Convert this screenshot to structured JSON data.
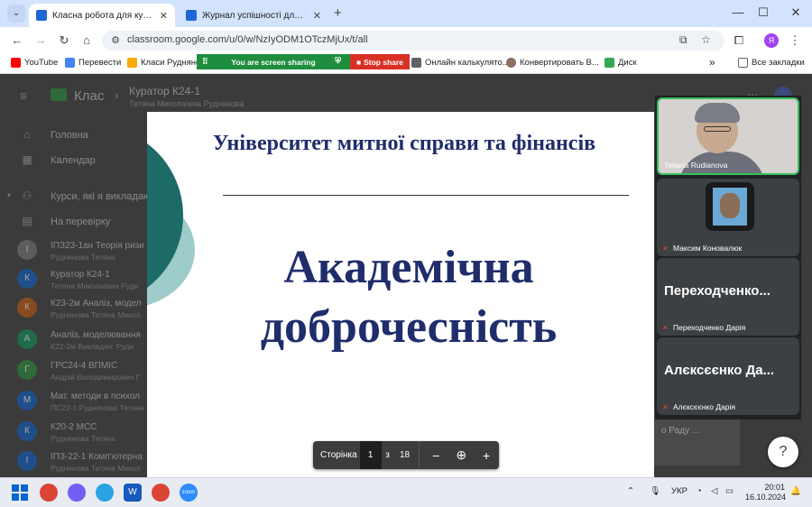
{
  "browser": {
    "tabs": [
      {
        "label": "Класна робота для курсу \"Кур",
        "active": true
      },
      {
        "label": "Журнал успішності для курсу \"",
        "active": false
      }
    ],
    "url": "classroom.google.com/u/0/w/NzIyODM1OTczMjUx/t/all",
    "profile_initial": "Я"
  },
  "bookmarks": {
    "items": [
      "YouTube",
      "Перевести",
      "Класи Руднянова",
      "Онлайн калькулято...",
      "Конвертировать В...",
      "Диск"
    ],
    "more": "»",
    "all_label": "Все закладки"
  },
  "screen_share": {
    "message": "You are screen sharing",
    "stop_label": "Stop share"
  },
  "classroom": {
    "app_name": "Клас",
    "course_title": "Куратор К24-1",
    "course_teacher": "Тетяна Миколаївна Руднянова",
    "nav": [
      {
        "label": "Головна",
        "icon": "home-icon"
      },
      {
        "label": "Календар",
        "icon": "calendar-icon"
      },
      {
        "label": "Курси, які я викладаю",
        "icon": "people-icon"
      },
      {
        "label": "На перевірку",
        "icon": "review-icon"
      }
    ],
    "courses": [
      {
        "initial": "І",
        "name": "ІПЗ23-1ан Теорія ризи",
        "teacher": "Руднянова Тетяна",
        "color": "#5c5c5c"
      },
      {
        "initial": "К",
        "name": "Куратор К24-1",
        "teacher": "Тетяна Миколаївна Рудн",
        "color": "#1f4f8a"
      },
      {
        "initial": "К",
        "name": "К23-2м Аналіз, модел",
        "teacher": "Руднянова Тетяна Микол",
        "color": "#8a4a1f"
      },
      {
        "initial": "А",
        "name": "Аналіз, моделювання",
        "teacher": "К22-2м Викладач: Рудн",
        "color": "#1f6b4a"
      },
      {
        "initial": "Г",
        "name": "ГРС24-4 ВПМІС",
        "teacher": "Андрій Володимирович Г",
        "color": "#2f6b3a"
      },
      {
        "initial": "М",
        "name": "Мат. методи в психол",
        "teacher": "ПС22-1 Руднянова Тетяна",
        "color": "#1f4f8a"
      },
      {
        "initial": "К",
        "name": "К20-2 МСС",
        "teacher": "Руднянова Тетяна",
        "color": "#1f4f8a"
      },
      {
        "initial": "І",
        "name": "ІПЗ-22-1 Комп'ютерна",
        "teacher": "Руднянова Тетяна Микол",
        "color": "#1f4f8a"
      }
    ],
    "right_card_text": "о Раду ..."
  },
  "slide": {
    "university": "Університет митної справи та фінансів",
    "title": "Академічна доброчесність"
  },
  "pager": {
    "label": "Сторінка",
    "current": "1",
    "of": "з",
    "total": "18"
  },
  "meet": {
    "participants": [
      {
        "name": "Tetiana Rudianova",
        "type": "video",
        "muted": false
      },
      {
        "name": "Максим Коновалюк",
        "type": "avatar",
        "muted": true
      },
      {
        "name": "Переходченко Дарія",
        "big": "Переходченко...",
        "type": "name",
        "muted": true
      },
      {
        "name": "Алєксєєнко Дарія",
        "big": "Алєксєєнко Да...",
        "type": "name",
        "muted": true
      }
    ]
  },
  "taskbar": {
    "lang": "УКР",
    "time": "20:01",
    "date": "16.10.2024"
  },
  "colors": {
    "slide_text": "#1f2d6b",
    "share_green": "#1e8e3e",
    "share_red": "#d93025",
    "slide_teal": "#1d6b67",
    "slide_light_teal": "#9dcccb"
  }
}
